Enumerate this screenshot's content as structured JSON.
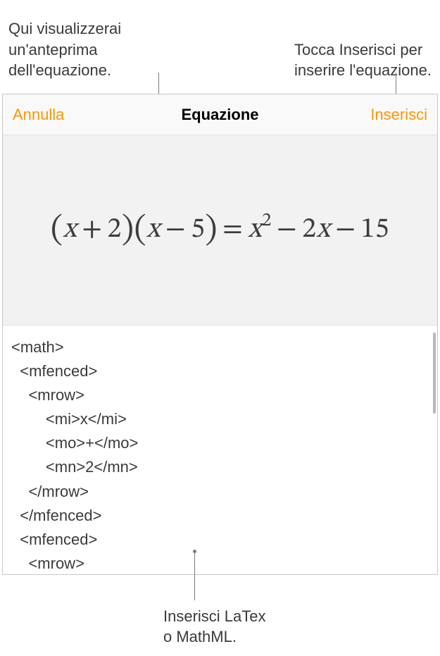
{
  "callouts": {
    "top_left_line1": "Qui visualizzerai",
    "top_left_line2": "un'anteprima",
    "top_left_line3": "dell'equazione.",
    "top_right_line1": "Tocca Inserisci per",
    "top_right_line2": "inserire l'equazione.",
    "bottom_line1": "Inserisci LaTex",
    "bottom_line2": "o MathML."
  },
  "toolbar": {
    "cancel_label": "Annulla",
    "title": "Equazione",
    "insert_label": "Inserisci"
  },
  "preview": {
    "equation_text": "(x + 2)(x − 5) = x² − 2x − 15"
  },
  "code": {
    "l0": "<math>",
    "l1": "  <mfenced>",
    "l2": "    <mrow>",
    "l3": "        <mi>x</mi>",
    "l4": "        <mo>+</mo>",
    "l5": "        <mn>2</mn>",
    "l6": "    </mrow>",
    "l7": "  </mfenced>",
    "l8": "  <mfenced>",
    "l9": "    <mrow>"
  }
}
